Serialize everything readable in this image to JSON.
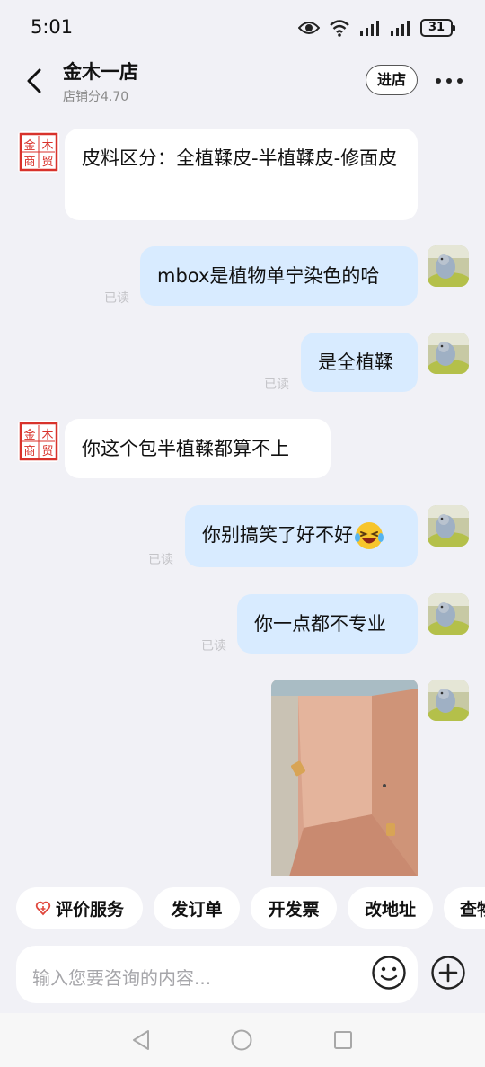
{
  "status_bar": {
    "time": "5:01",
    "battery": "31"
  },
  "header": {
    "shop_name": "金木一店",
    "shop_score": "店铺分4.70",
    "enter_shop_label": "进店"
  },
  "shop_seal": {
    "text": "金木商贸"
  },
  "messages": [
    {
      "from": "shop",
      "text": "皮料区分：全植鞣皮-半植鞣皮-修面皮"
    },
    {
      "from": "me",
      "text": "mbox是植物单宁染色的哈",
      "read": "已读"
    },
    {
      "from": "me",
      "text": "是全植鞣",
      "read": "已读"
    },
    {
      "from": "shop",
      "text": "你这个包半植鞣都算不上"
    },
    {
      "from": "me",
      "text": "你别搞笑了好不好",
      "emoji": "laughing-crying-emoji",
      "read": "已读"
    },
    {
      "from": "me",
      "text": "你一点都不专业",
      "read": "已读"
    },
    {
      "from": "me",
      "type": "image",
      "image": "bag-interior-photo"
    }
  ],
  "quick_actions": [
    "评价服务",
    "发订单",
    "开发票",
    "改地址",
    "查物"
  ],
  "input": {
    "placeholder": "输入您要咨询的内容..."
  },
  "colors": {
    "background": "#f1f1f6",
    "incoming_bubble": "#ffffff",
    "outgoing_bubble": "#d8ebff",
    "seal_red": "#d8322b",
    "heart": "#e0463c"
  }
}
